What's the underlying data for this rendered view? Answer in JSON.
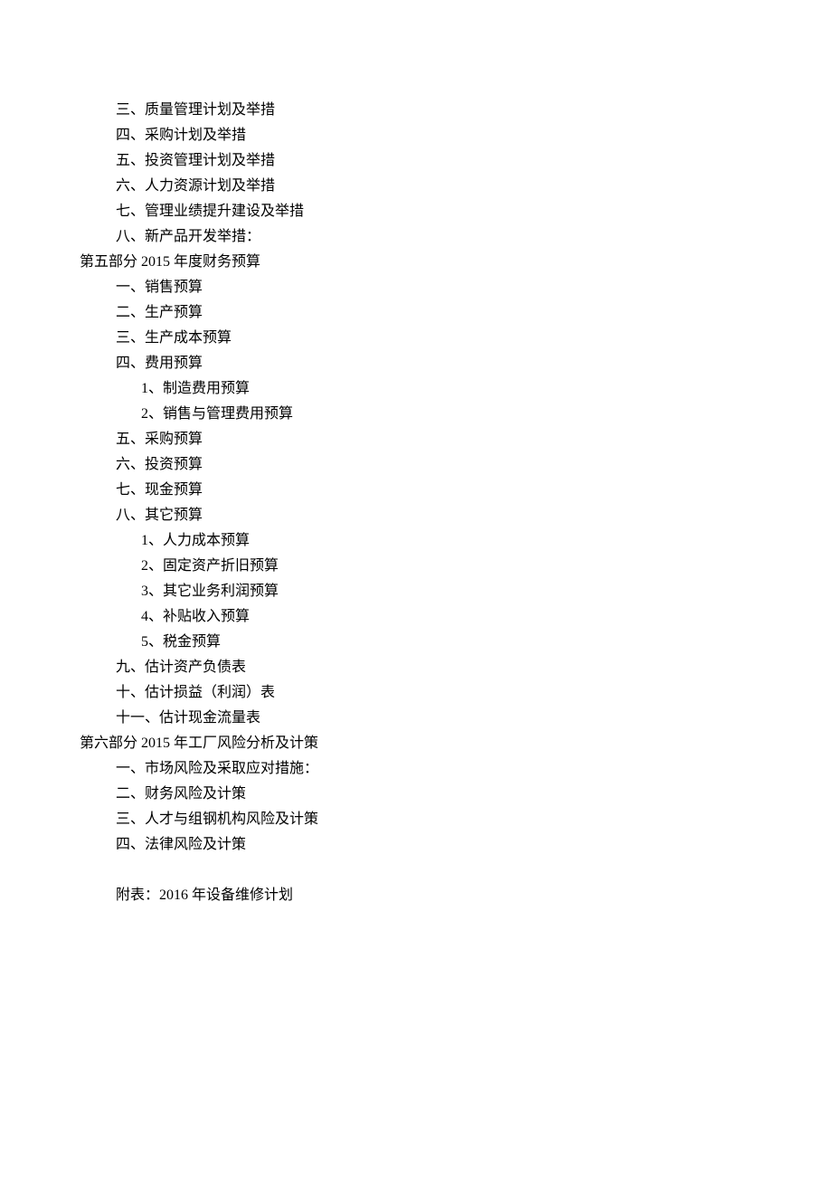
{
  "lines": [
    {
      "indent": 1,
      "text": "三、质量管理计划及举措"
    },
    {
      "indent": 1,
      "text": "四、采购计划及举措"
    },
    {
      "indent": 1,
      "text": "五、投资管理计划及举措"
    },
    {
      "indent": 1,
      "text": "六、人力资源计划及举措"
    },
    {
      "indent": 1,
      "text": "七、管理业绩提升建设及举措"
    },
    {
      "indent": 1,
      "text": "八、新产品开发举措："
    },
    {
      "indent": 0,
      "text": "第五部分 2015 年度财务预算"
    },
    {
      "indent": 1,
      "text": "一、销售预算"
    },
    {
      "indent": 1,
      "text": "二、生产预算"
    },
    {
      "indent": 1,
      "text": "三、生产成本预算"
    },
    {
      "indent": 1,
      "text": "四、费用预算"
    },
    {
      "indent": 2,
      "text": "1、制造费用预算"
    },
    {
      "indent": 2,
      "text": "2、销售与管理费用预算"
    },
    {
      "indent": 1,
      "text": "五、采购预算"
    },
    {
      "indent": 1,
      "text": "六、投资预算"
    },
    {
      "indent": 1,
      "text": "七、现金预算"
    },
    {
      "indent": 1,
      "text": "八、其它预算"
    },
    {
      "indent": 2,
      "text": "1、人力成本预算"
    },
    {
      "indent": 2,
      "text": "2、固定资产折旧预算"
    },
    {
      "indent": 2,
      "text": "3、其它业务利润预算"
    },
    {
      "indent": 2,
      "text": "4、补贴收入预算"
    },
    {
      "indent": 2,
      "text": "5、税金预算"
    },
    {
      "indent": 1,
      "text": "九、估计资产负债表"
    },
    {
      "indent": 1,
      "text": "十、估计损益（利润）表"
    },
    {
      "indent": 1,
      "text": "十一、估计现金流量表"
    },
    {
      "indent": 0,
      "text": "第六部分 2015 年工厂风险分析及计策"
    },
    {
      "indent": 1,
      "text": "一、市场风险及采取应对措施："
    },
    {
      "indent": 1,
      "text": "二、财务风险及计策"
    },
    {
      "indent": 1,
      "text": "三、人才与组钢机构风险及计策"
    },
    {
      "indent": 1,
      "text": "四、法律风险及计策"
    }
  ],
  "appendix": "附表：2016 年设备维修计划"
}
